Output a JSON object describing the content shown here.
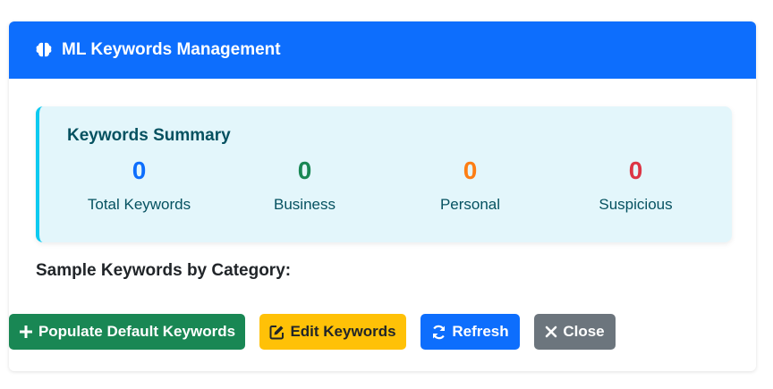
{
  "header": {
    "title": "ML Keywords Management",
    "icon": "brain-icon",
    "color": "#0d6efd"
  },
  "summary": {
    "title": "Keywords Summary",
    "stats": [
      {
        "value": "0",
        "label": "Total Keywords",
        "color": "#0d6efd"
      },
      {
        "value": "0",
        "label": "Business",
        "color": "#198754"
      },
      {
        "value": "0",
        "label": "Personal",
        "color": "#fd7e14"
      },
      {
        "value": "0",
        "label": "Suspicious",
        "color": "#dc3545"
      }
    ]
  },
  "section": {
    "title": "Sample Keywords by Category:"
  },
  "buttons": {
    "populate": {
      "label": "Populate Default Keywords",
      "icon": "plus-icon",
      "color": "#198754"
    },
    "edit": {
      "label": "Edit Keywords",
      "icon": "edit-icon",
      "color": "#ffc107"
    },
    "refresh": {
      "label": "Refresh",
      "icon": "refresh-icon",
      "color": "#0d6efd"
    },
    "close": {
      "label": "Close",
      "icon": "close-icon",
      "color": "#6c757d"
    }
  }
}
